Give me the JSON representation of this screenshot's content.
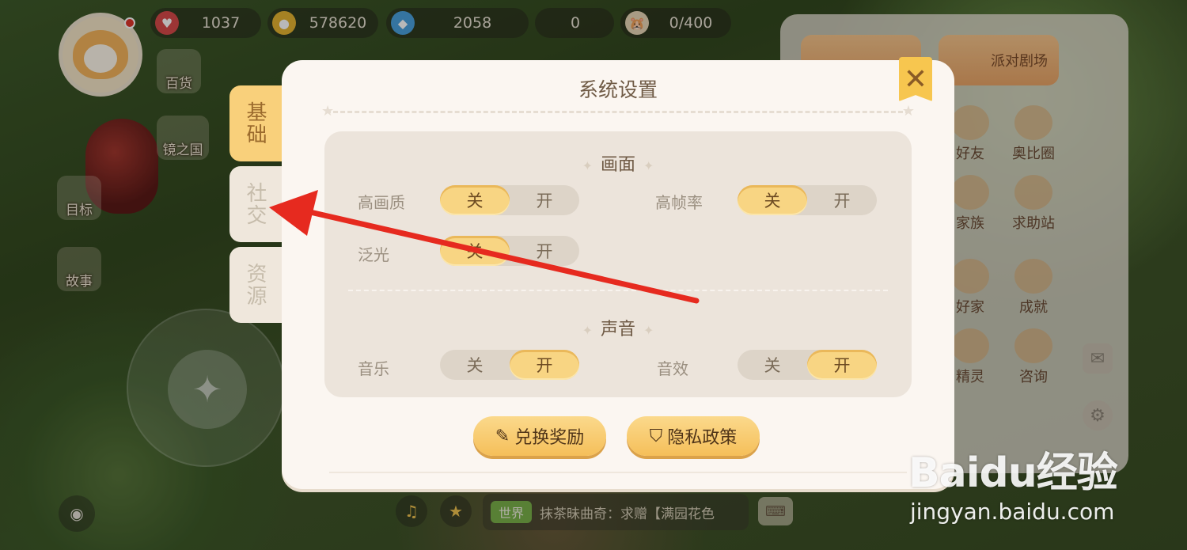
{
  "hud": {
    "hearts": "1037",
    "coins": "578620",
    "gems": "2058",
    "tickets": "0",
    "capacity": "0/400"
  },
  "left_icons": {
    "store": "百货",
    "target": "目标",
    "story": "故事",
    "mirror_land": "镜之国",
    "new_badge": "new"
  },
  "right_panel": {
    "party": "派对剧场",
    "friends": "好友",
    "aobi_circle": "奥比圈",
    "family": "家族",
    "help": "求助站",
    "good_home": "好家",
    "achievement": "成就",
    "spirit": "精灵",
    "consult": "咨询"
  },
  "chat": {
    "channel": "世界",
    "message": "抹茶昧曲奇：求赠【满园花色"
  },
  "dialog": {
    "title": "系统设置",
    "tabs": [
      {
        "label": "基础",
        "active": true
      },
      {
        "label": "社交",
        "active": false
      },
      {
        "label": "资源",
        "active": false
      }
    ],
    "graphics": {
      "title": "画面",
      "high_quality": {
        "label": "高画质",
        "off": "关",
        "on": "开",
        "state": "off"
      },
      "high_framerate": {
        "label": "高帧率",
        "off": "关",
        "on": "开",
        "state": "off"
      },
      "bloom": {
        "label": "泛光",
        "off": "关",
        "on": "开",
        "state": "off"
      }
    },
    "sound": {
      "title": "声音",
      "music": {
        "label": "音乐",
        "off": "关",
        "on": "开",
        "state": "on"
      },
      "sfx": {
        "label": "音效",
        "off": "关",
        "on": "开",
        "state": "on"
      }
    },
    "buttons": {
      "redeem": "兑换奖励",
      "privacy": "隐私政策"
    }
  },
  "watermark": {
    "logo": "Baidu经验",
    "url": "jingyan.baidu.com"
  },
  "colors": {
    "accent": "#f8d583",
    "arrow": "#e62a1f"
  }
}
